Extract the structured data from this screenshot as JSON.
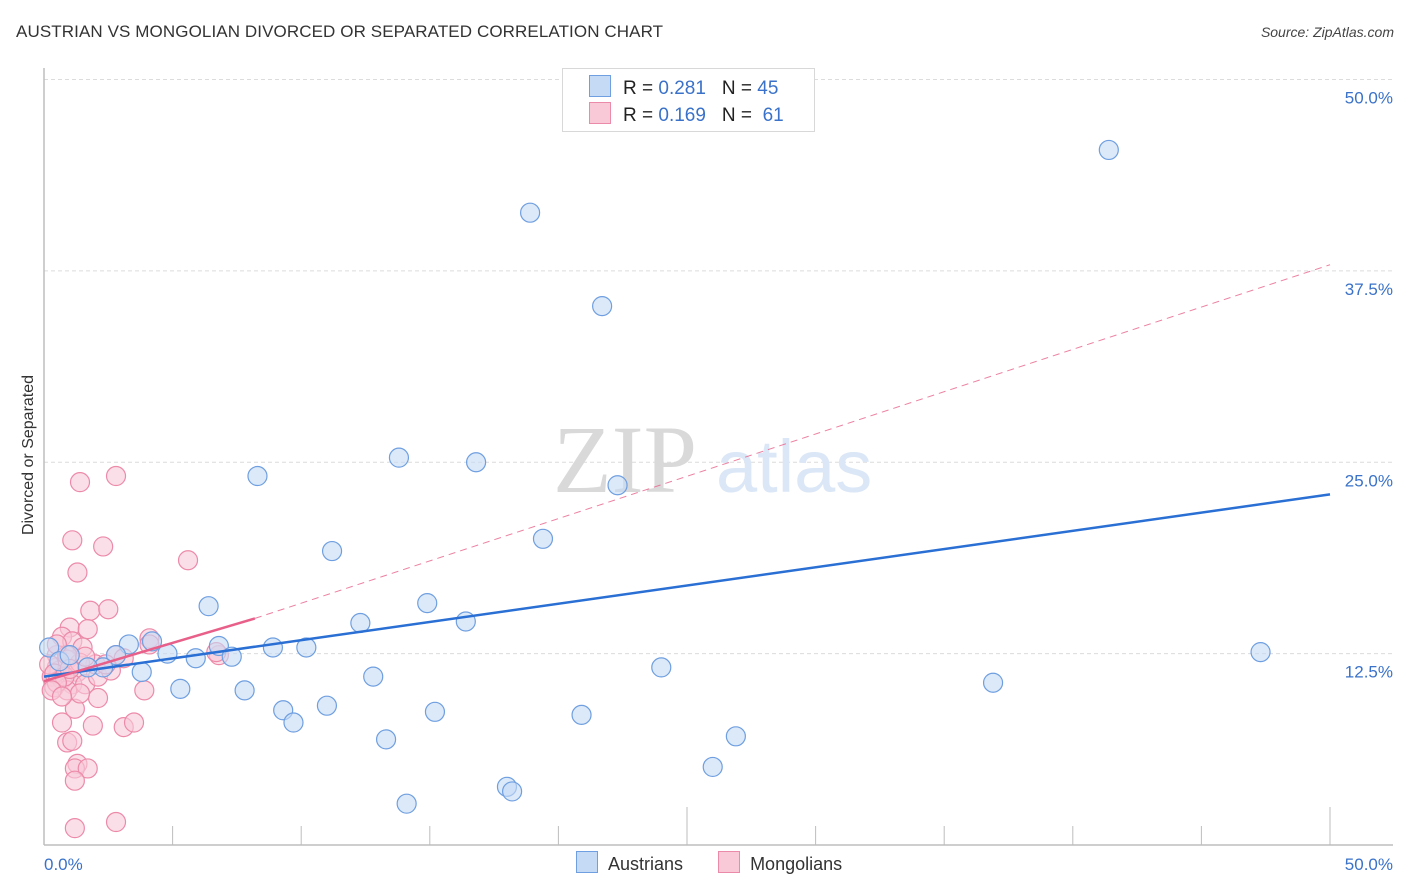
{
  "header": {
    "title": "AUSTRIAN VS MONGOLIAN DIVORCED OR SEPARATED CORRELATION CHART",
    "source": "Source: ZipAtlas.com"
  },
  "legend_top": {
    "rows": [
      {
        "r_label": "R = ",
        "r_value": "0.281",
        "n_label": "N = ",
        "n_value": "45",
        "color": "#a9c8f2"
      },
      {
        "r_label": "R = ",
        "r_value": "0.169",
        "n_label": "N = ",
        "n_value": " 61",
        "color": "#f8bcd0"
      }
    ]
  },
  "legend_bottom": {
    "items": [
      {
        "label": "Austrians",
        "color": "#a9c8f2"
      },
      {
        "label": "Mongolians",
        "color": "#f8bcd0"
      }
    ]
  },
  "watermark": {
    "zip": "ZIP",
    "atlas": "atlas"
  },
  "chart_data": {
    "type": "scatter",
    "title": "AUSTRIAN VS MONGOLIAN DIVORCED OR SEPARATED CORRELATION CHART",
    "xlabel": "",
    "ylabel": "Divorced or Separated",
    "xlim": [
      0,
      50
    ],
    "ylim": [
      0,
      50
    ],
    "x_tick_labels": [
      "0.0%",
      "50.0%"
    ],
    "y_ticks": [
      12.5,
      25.0,
      37.5,
      50.0
    ],
    "y_tick_labels": [
      "12.5%",
      "25.0%",
      "37.5%",
      "50.0%"
    ],
    "grid": true,
    "legend_position": "top-center",
    "series": [
      {
        "name": "Austrians",
        "color": "#6f9fe0",
        "fill": "#c5daf5",
        "line_color": "#2a6fd4",
        "R": 0.281,
        "N": 45,
        "trend": {
          "x": [
            0,
            50
          ],
          "y": [
            11.0,
            22.9
          ],
          "style": "solid"
        },
        "points": [
          [
            41.4,
            45.4
          ],
          [
            18.9,
            41.3
          ],
          [
            21.7,
            35.2
          ],
          [
            13.8,
            25.3
          ],
          [
            16.8,
            25.0
          ],
          [
            8.3,
            24.1
          ],
          [
            22.3,
            23.5
          ],
          [
            19.4,
            20.0
          ],
          [
            11.2,
            19.2
          ],
          [
            6.4,
            15.6
          ],
          [
            14.9,
            15.8
          ],
          [
            12.3,
            14.5
          ],
          [
            16.4,
            14.6
          ],
          [
            4.2,
            13.3
          ],
          [
            3.3,
            13.1
          ],
          [
            6.8,
            13.0
          ],
          [
            8.9,
            12.9
          ],
          [
            10.2,
            12.9
          ],
          [
            4.8,
            12.5
          ],
          [
            5.9,
            12.2
          ],
          [
            7.3,
            12.3
          ],
          [
            2.8,
            12.4
          ],
          [
            0.2,
            12.9
          ],
          [
            2.3,
            11.6
          ],
          [
            1.7,
            11.6
          ],
          [
            3.8,
            11.3
          ],
          [
            24.0,
            11.6
          ],
          [
            47.3,
            12.6
          ],
          [
            12.8,
            11.0
          ],
          [
            5.3,
            10.2
          ],
          [
            7.8,
            10.1
          ],
          [
            36.9,
            10.6
          ],
          [
            9.3,
            8.8
          ],
          [
            11.0,
            9.1
          ],
          [
            15.2,
            8.7
          ],
          [
            20.9,
            8.5
          ],
          [
            9.7,
            8.0
          ],
          [
            13.3,
            6.9
          ],
          [
            26.9,
            7.1
          ],
          [
            26.0,
            5.1
          ],
          [
            18.0,
            3.8
          ],
          [
            18.2,
            3.5
          ],
          [
            14.1,
            2.7
          ],
          [
            0.6,
            12.0
          ],
          [
            1.0,
            12.4
          ]
        ]
      },
      {
        "name": "Mongolians",
        "color": "#ec8aa9",
        "fill": "#f9c9d8",
        "line_color": "#e8608a",
        "R": 0.169,
        "N": 61,
        "trend": {
          "x": [
            0,
            8.2
          ],
          "y": [
            10.7,
            14.8
          ],
          "style": "solid",
          "extension": {
            "x": [
              8.2,
              50
            ],
            "y": [
              14.8,
              37.9
            ],
            "style": "dashed"
          }
        },
        "points": [
          [
            1.4,
            23.7
          ],
          [
            2.8,
            24.1
          ],
          [
            1.1,
            19.9
          ],
          [
            2.3,
            19.5
          ],
          [
            1.3,
            17.8
          ],
          [
            5.6,
            18.6
          ],
          [
            1.8,
            15.3
          ],
          [
            2.5,
            15.4
          ],
          [
            1.0,
            14.2
          ],
          [
            1.7,
            14.1
          ],
          [
            0.7,
            13.6
          ],
          [
            1.1,
            13.3
          ],
          [
            4.1,
            13.5
          ],
          [
            1.5,
            12.9
          ],
          [
            0.5,
            12.4
          ],
          [
            0.9,
            12.1
          ],
          [
            0.5,
            11.6
          ],
          [
            1.3,
            11.3
          ],
          [
            0.3,
            11.0
          ],
          [
            0.7,
            10.8
          ],
          [
            1.1,
            10.5
          ],
          [
            0.4,
            10.3
          ],
          [
            0.9,
            10.1
          ],
          [
            1.6,
            10.5
          ],
          [
            2.1,
            11.0
          ],
          [
            2.6,
            11.4
          ],
          [
            2.0,
            11.8
          ],
          [
            0.6,
            11.4
          ],
          [
            0.2,
            11.8
          ],
          [
            1.4,
            11.9
          ],
          [
            0.9,
            12.4
          ],
          [
            6.8,
            12.4
          ],
          [
            3.9,
            10.1
          ],
          [
            2.1,
            9.6
          ],
          [
            1.2,
            8.9
          ],
          [
            0.7,
            8.0
          ],
          [
            1.9,
            7.8
          ],
          [
            3.1,
            7.7
          ],
          [
            3.5,
            8.0
          ],
          [
            0.9,
            6.7
          ],
          [
            1.1,
            6.8
          ],
          [
            1.3,
            5.3
          ],
          [
            1.2,
            5.0
          ],
          [
            1.7,
            5.0
          ],
          [
            1.2,
            4.2
          ],
          [
            1.2,
            1.1
          ],
          [
            2.8,
            1.5
          ],
          [
            0.5,
            13.1
          ],
          [
            0.4,
            11.2
          ],
          [
            0.8,
            11.0
          ],
          [
            1.0,
            11.5
          ],
          [
            0.5,
            10.6
          ],
          [
            1.6,
            12.3
          ],
          [
            2.8,
            12.4
          ],
          [
            3.1,
            12.2
          ],
          [
            2.4,
            11.8
          ],
          [
            0.3,
            10.1
          ],
          [
            1.4,
            9.9
          ],
          [
            0.7,
            9.7
          ],
          [
            4.1,
            13.1
          ],
          [
            6.7,
            12.6
          ]
        ]
      }
    ]
  }
}
